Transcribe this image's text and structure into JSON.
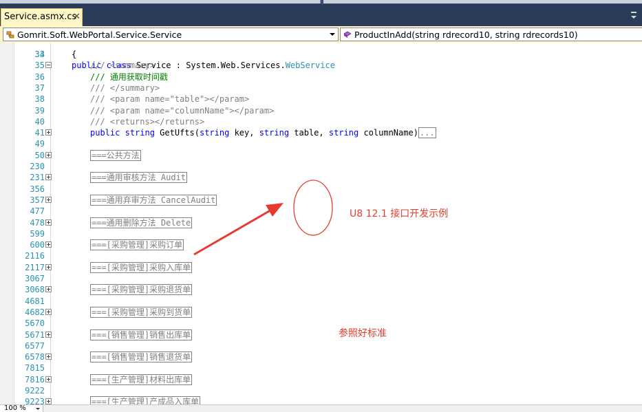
{
  "tab": {
    "title": "Service.asmx.cs",
    "close_glyph": "✕"
  },
  "nav": {
    "class_combo": "Gomrit.Soft.WebPortal.Service.Service",
    "member_combo": "ProductInAdd(string rdrecord10, string rdrecords10)"
  },
  "editor": {
    "header_line": {
      "ln": "33",
      "text": "public class Service : System.Web.Services.WebService"
    },
    "lines": [
      {
        "ln": "34",
        "text": "{"
      },
      {
        "ln": "35",
        "text": "/// <summary>"
      },
      {
        "ln": "36",
        "text": "/// 通用获取时间戳"
      },
      {
        "ln": "37",
        "text": "/// </summary>"
      },
      {
        "ln": "38",
        "text": "/// <param name=\"table\"></param>"
      },
      {
        "ln": "39",
        "text": "/// <param name=\"columnName\"></param>"
      },
      {
        "ln": "40",
        "text": "/// <returns></returns>"
      },
      {
        "ln": "41",
        "text": "public string GetUfts(string key, string table, string columnName)",
        "collapsed": "..."
      },
      {
        "ln": "49",
        "text": ""
      },
      {
        "ln": "50",
        "text": "===公共方法"
      },
      {
        "ln": "230",
        "text": ""
      },
      {
        "ln": "231",
        "text": "===通用审核方法 Audit"
      },
      {
        "ln": "356",
        "text": ""
      },
      {
        "ln": "357",
        "text": "===通用弃审方法 CancelAudit"
      },
      {
        "ln": "477",
        "text": ""
      },
      {
        "ln": "478",
        "text": "===通用删除方法 Delete"
      },
      {
        "ln": "599",
        "text": ""
      },
      {
        "ln": "600",
        "text": "===[采购管理]采购订单"
      },
      {
        "ln": "2116",
        "text": ""
      },
      {
        "ln": "2117",
        "text": "===[采购管理]采购入库单"
      },
      {
        "ln": "3067",
        "text": ""
      },
      {
        "ln": "3068",
        "text": "===[采购管理]采购退货单"
      },
      {
        "ln": "4681",
        "text": ""
      },
      {
        "ln": "4682",
        "text": "===[采购管理]采购到货单"
      },
      {
        "ln": "5670",
        "text": ""
      },
      {
        "ln": "5671",
        "text": "===[销售管理]销售出库单"
      },
      {
        "ln": "6577",
        "text": ""
      },
      {
        "ln": "6578",
        "text": "===[销售管理]销售退货单"
      },
      {
        "ln": "7815",
        "text": ""
      },
      {
        "ln": "7816",
        "text": "===[生产管理]材料出库单"
      },
      {
        "ln": "9222",
        "text": ""
      },
      {
        "ln": "9223",
        "text": "===[生产管理]产成品入库单"
      }
    ]
  },
  "annotations": {
    "title_note": "U8 12.1 接口开发示例",
    "ref_note": "参照好标准"
  },
  "status": {
    "zoom": "100 %"
  },
  "colors": {
    "annotation": "#e53c2f",
    "keyword": "#0000ff",
    "comment": "#008000",
    "line_number": "#2b91af"
  }
}
